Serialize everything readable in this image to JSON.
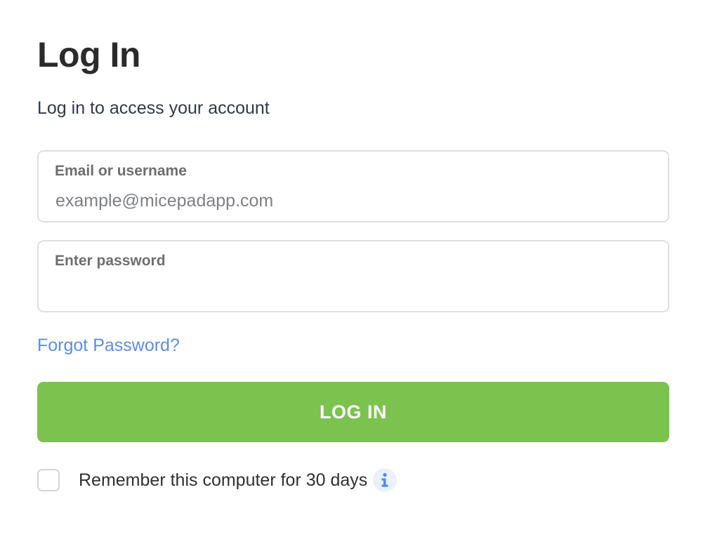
{
  "header": {
    "title": "Log In",
    "subtitle": "Log in to access your account"
  },
  "form": {
    "email": {
      "label": "Email or username",
      "placeholder": "example@micepadapp.com",
      "value": ""
    },
    "password": {
      "label": "Enter password",
      "placeholder": "",
      "value": ""
    },
    "forgot_password": "Forgot Password?",
    "submit_label": "LOG IN",
    "remember": {
      "label": "Remember this computer for 30 days",
      "checked": false,
      "info_icon": "info-icon"
    }
  },
  "colors": {
    "accent_green": "#7bc24f",
    "link_blue": "#5b8def",
    "info_blue": "#4f87ee"
  }
}
